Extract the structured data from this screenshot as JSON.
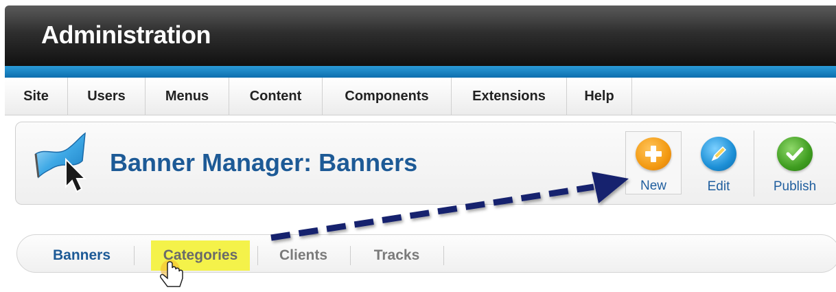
{
  "header": {
    "title": "Administration"
  },
  "menu": {
    "items": [
      {
        "label": "Site",
        "width": 92
      },
      {
        "label": "Users",
        "width": 113
      },
      {
        "label": "Menus",
        "width": 122
      },
      {
        "label": "Content",
        "width": 136
      },
      {
        "label": "Components",
        "width": 188
      },
      {
        "label": "Extensions",
        "width": 168
      },
      {
        "label": "Help",
        "width": 95
      }
    ]
  },
  "toolbar": {
    "page_title": "Banner Manager: Banners",
    "buttons": {
      "new": {
        "label": "New",
        "icon": "plus-icon",
        "color": "#f39a12"
      },
      "edit": {
        "label": "Edit",
        "icon": "pencil-icon",
        "color": "#1c8fd6"
      },
      "publish": {
        "label": "Publish",
        "icon": "check-icon",
        "color": "#3f9d20"
      }
    }
  },
  "subtabs": {
    "banners": "Banners",
    "categories": "Categories",
    "clients": "Clients",
    "tracks": "Tracks"
  },
  "colors": {
    "title_blue": "#1d5a96",
    "highlight_yellow": "#f4f24a",
    "arrow_navy": "#14206e"
  }
}
